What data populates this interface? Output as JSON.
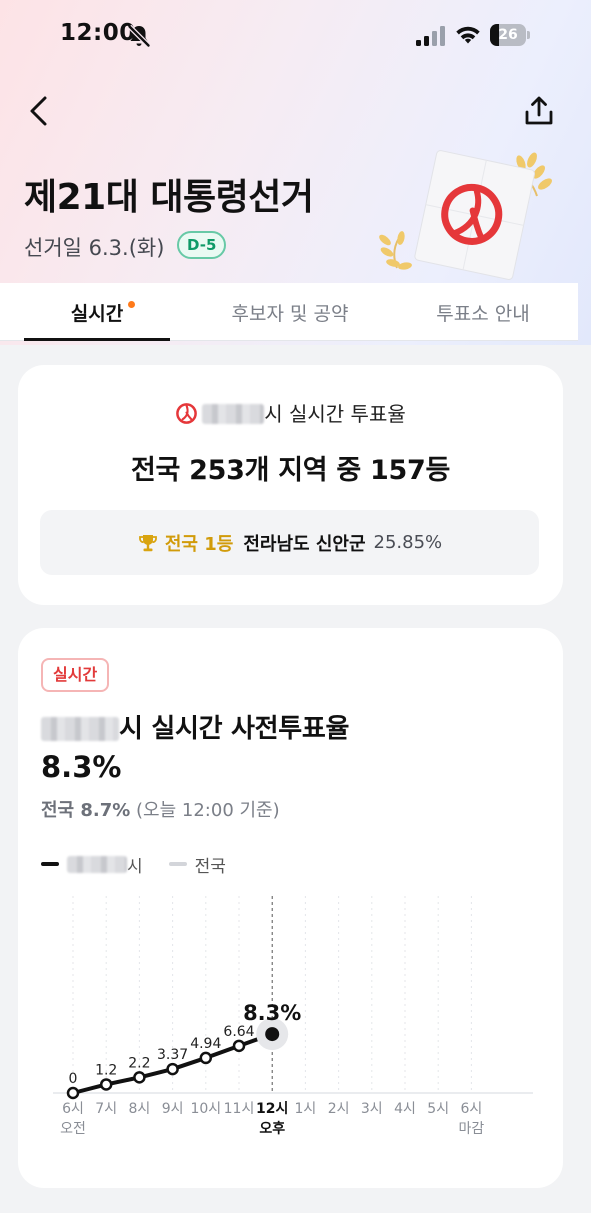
{
  "status_bar": {
    "time": "12:00",
    "battery": "26",
    "battery_level": 0.26
  },
  "header": {
    "title": "제21대 대통령선거",
    "election_date": "선거일 6.3.(화)",
    "dday": "D-5"
  },
  "tabs": [
    {
      "label": "실시간",
      "active": true,
      "has_dot": true
    },
    {
      "label": "후보자 및 공약",
      "active": false
    },
    {
      "label": "투표소 안내",
      "active": false
    }
  ],
  "turnout_card": {
    "line_suffix": "시 실시간 투표율",
    "rank_text": "전국 253개 지역 중 157등",
    "top_rank_label": "전국 1등",
    "top_region": "전라남도 신안군",
    "top_rate": "25.85%"
  },
  "chart_card": {
    "badge": "실시간",
    "title_suffix": "시 실시간 사전투표율",
    "current_rate": "8.3%",
    "national_label": "전국 8.7%",
    "national_note": " (오늘 12:00 기준)",
    "legend_local": "시",
    "legend_national": "전국"
  },
  "chart_data": {
    "type": "line",
    "categories": [
      "6시",
      "7시",
      "8시",
      "9시",
      "10시",
      "11시",
      "12시",
      "1시",
      "2시",
      "3시",
      "4시",
      "5시",
      "6시"
    ],
    "sublabels": [
      "오전",
      "",
      "",
      "",
      "",
      "",
      "오후",
      "",
      "",
      "",
      "",
      "",
      "마감"
    ],
    "current_index": 6,
    "series": [
      {
        "name": "시",
        "values": [
          0,
          1.2,
          2.2,
          3.37,
          4.94,
          6.64,
          8.3
        ],
        "labels": [
          "0",
          "1.2",
          "2.2",
          "3.37",
          "4.94",
          "6.64",
          "8.3%"
        ],
        "color": "#111111"
      }
    ],
    "ylim": [
      0,
      25
    ],
    "grid": true
  }
}
